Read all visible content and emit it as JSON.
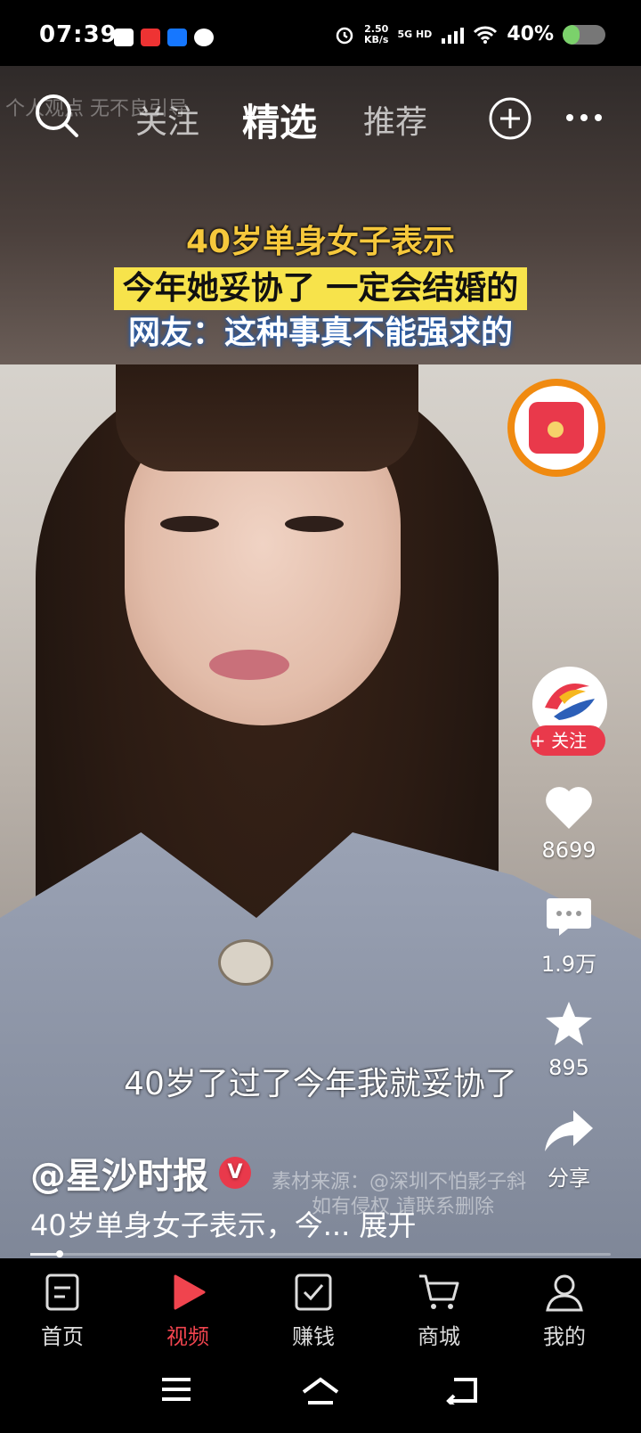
{
  "status": {
    "time": "07:39",
    "net_speed_value": "2.50",
    "net_speed_unit": "KB/s",
    "network": "5G HD",
    "battery": "40%",
    "battery_level": 0.4
  },
  "nav": {
    "watermark": "个人观点 无不良引导",
    "tabs": [
      "关注",
      "精选",
      "推荐"
    ],
    "active_tab": "精选"
  },
  "headline": {
    "line1": "40岁单身女子表示",
    "line2": "今年她妥协了 一定会结婚的",
    "line3": "网友：这种事真不能强求的"
  },
  "side": {
    "follow_label": "+ 关注",
    "likes": "8699",
    "comments": "1.9万",
    "favorites": "895",
    "share_label": "分享"
  },
  "video": {
    "subtitle": "40岁了过了今年我就妥协了",
    "source_note_line1": "素材来源：@深圳不怕影子斜",
    "source_note_line2": "如有侵权 请联系删除",
    "author": "@星沙时报",
    "description": "40岁单身女子表示，今...",
    "expand_label": "展开",
    "progress": 0.05
  },
  "tabbar": {
    "items": [
      {
        "label": "首页",
        "icon": "home-doc-icon"
      },
      {
        "label": "视频",
        "icon": "play-icon"
      },
      {
        "label": "赚钱",
        "icon": "checkbox-icon"
      },
      {
        "label": "商城",
        "icon": "cart-icon"
      },
      {
        "label": "我的",
        "icon": "person-icon"
      }
    ],
    "active": "视频"
  },
  "colors": {
    "accent": "#f0444e",
    "headline_yellow": "#f7e34b",
    "red_packet_ring": "#f08a10"
  }
}
